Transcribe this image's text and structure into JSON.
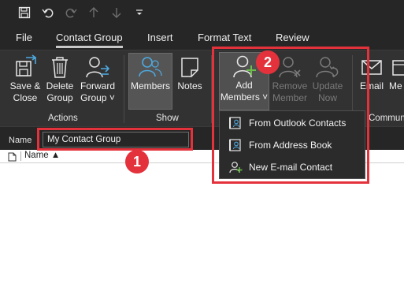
{
  "quick_access": {
    "icons": [
      "save-icon",
      "undo-icon",
      "redo-icon",
      "up-arrow-icon",
      "down-arrow-icon",
      "customize-icon"
    ]
  },
  "tabs": [
    {
      "label": "File"
    },
    {
      "label": "Contact Group",
      "active": true
    },
    {
      "label": "Insert"
    },
    {
      "label": "Format Text"
    },
    {
      "label": "Review"
    }
  ],
  "ribbon": {
    "actions": {
      "group_label": "Actions",
      "save_close": {
        "line1": "Save &",
        "line2": "Close"
      },
      "delete_group": {
        "line1": "Delete",
        "line2": "Group"
      },
      "forward_group": {
        "line1": "Forward",
        "line2": "Group ˅"
      }
    },
    "show": {
      "group_label": "Show",
      "members": "Members",
      "notes": "Notes"
    },
    "members": {
      "add": {
        "line1": "Add",
        "line2": "Members ˅"
      },
      "remove": {
        "line1": "Remove",
        "line2": "Member"
      },
      "update": {
        "line1": "Update",
        "line2": "Now"
      }
    },
    "communicate": {
      "group_label": "Communic",
      "email": "Email",
      "meeting": "Me"
    }
  },
  "name_row": {
    "label": "Name",
    "value": "My Contact Group"
  },
  "list": {
    "column_name": "Name ▲"
  },
  "dropdown": {
    "items": [
      {
        "label": "From Outlook Contacts",
        "icon": "address-book-icon"
      },
      {
        "label": "From Address Book",
        "icon": "address-book-icon"
      },
      {
        "label": "New E-mail Contact",
        "icon": "new-contact-icon"
      }
    ]
  },
  "annotations": {
    "badge1": "1",
    "badge2": "2"
  },
  "colors": {
    "highlight": "#e4323c",
    "accent_blue": "#4ea8de",
    "accent_green": "#6cc04a"
  }
}
